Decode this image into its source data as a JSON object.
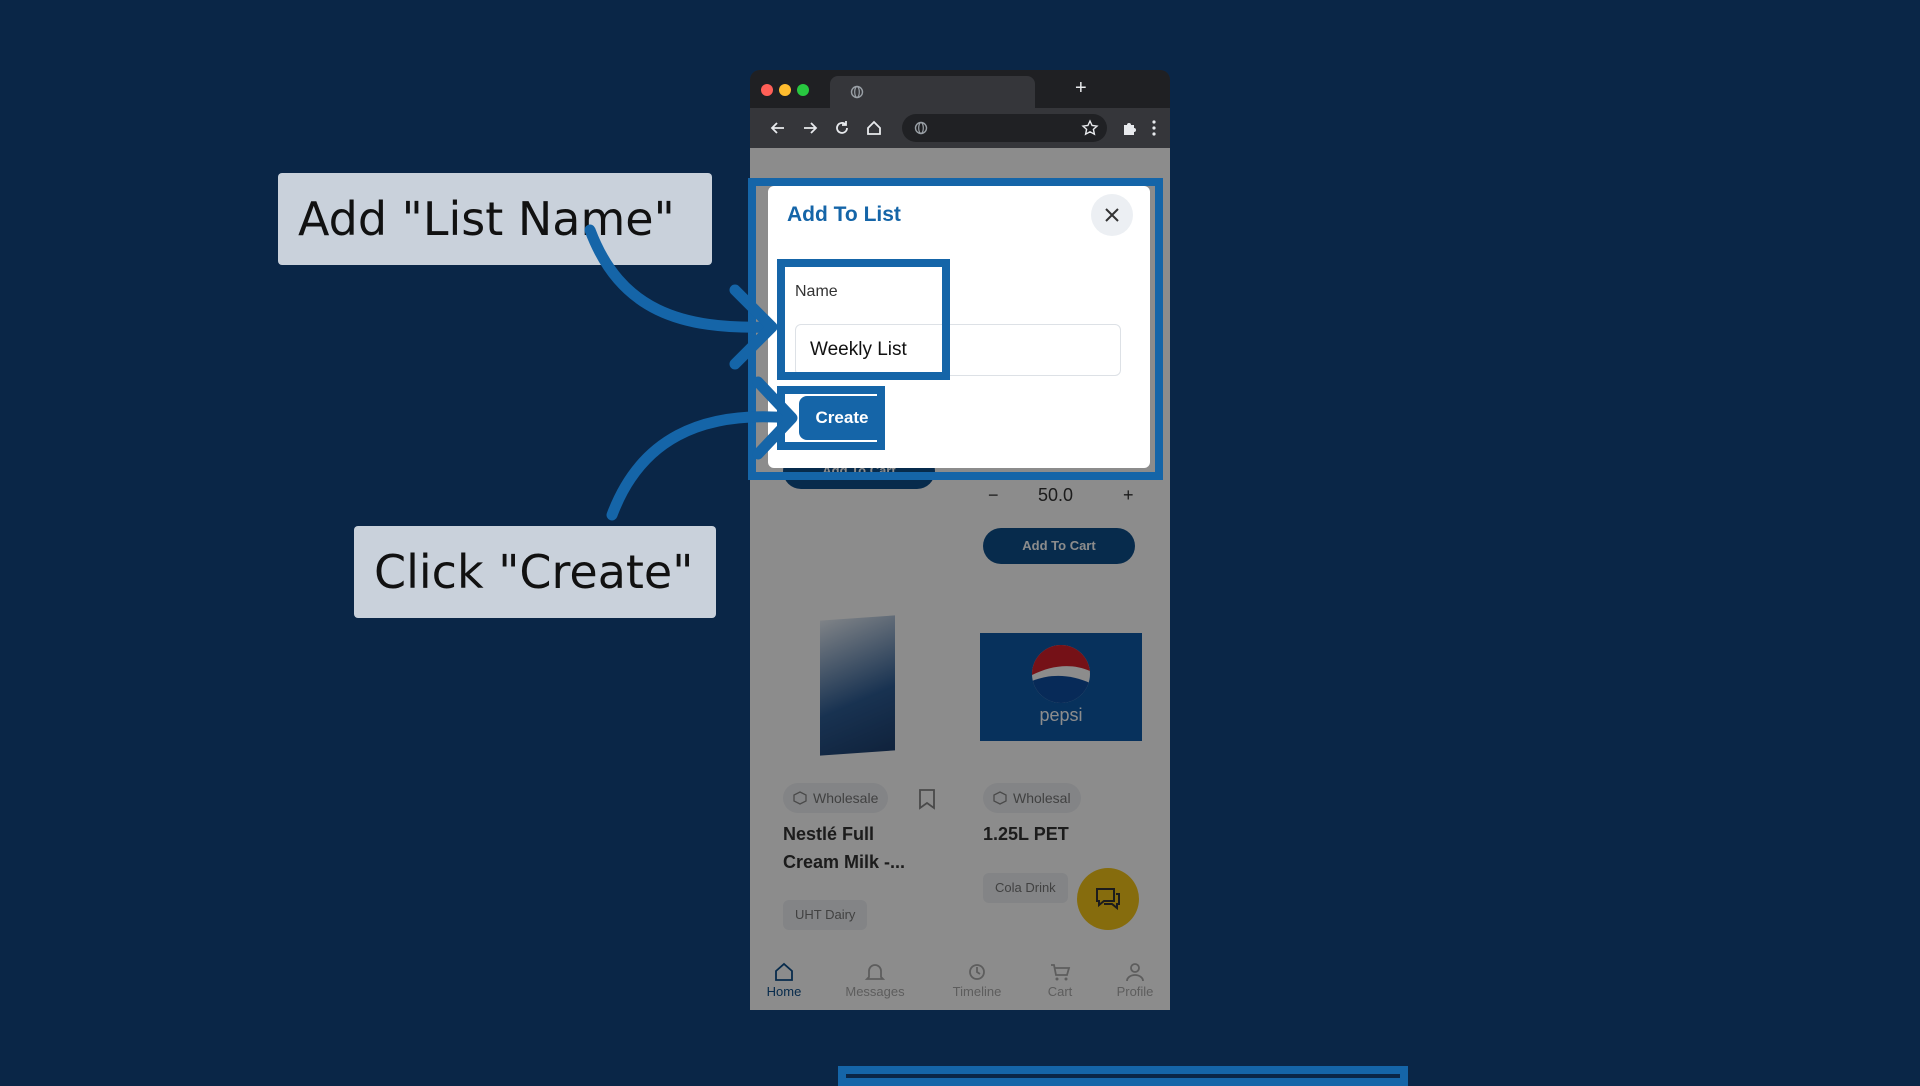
{
  "browser": {
    "tab_icon": "globe-icon",
    "new_tab_label": "+"
  },
  "page": {
    "add_to_cart_label": "Add To Cart",
    "quantity_value": "50.0",
    "quantity_minus": "−",
    "quantity_plus": "+",
    "products": [
      {
        "badge": "Wholesale",
        "name_line1": "Nestlé Full",
        "name_line2": "Cream Milk -...",
        "category": "UHT Dairy"
      },
      {
        "badge": "Wholesal",
        "name_line1": "1.25L PET",
        "category": "Cola Drink",
        "logo_text": "pepsi"
      }
    ],
    "bottom_nav": [
      "Home",
      "Messages",
      "Timeline",
      "Cart",
      "Profile"
    ]
  },
  "modal": {
    "title": "Add To List",
    "name_label": "Name",
    "name_value": "Weekly List",
    "create_label": "Create"
  },
  "annotations": {
    "callout_1": "Add \"List Name\"",
    "callout_2": "Click \"Create\"",
    "accent_color": "#1565a8",
    "callout_bg": "#c9d1db",
    "background_color": "#0a2647"
  }
}
